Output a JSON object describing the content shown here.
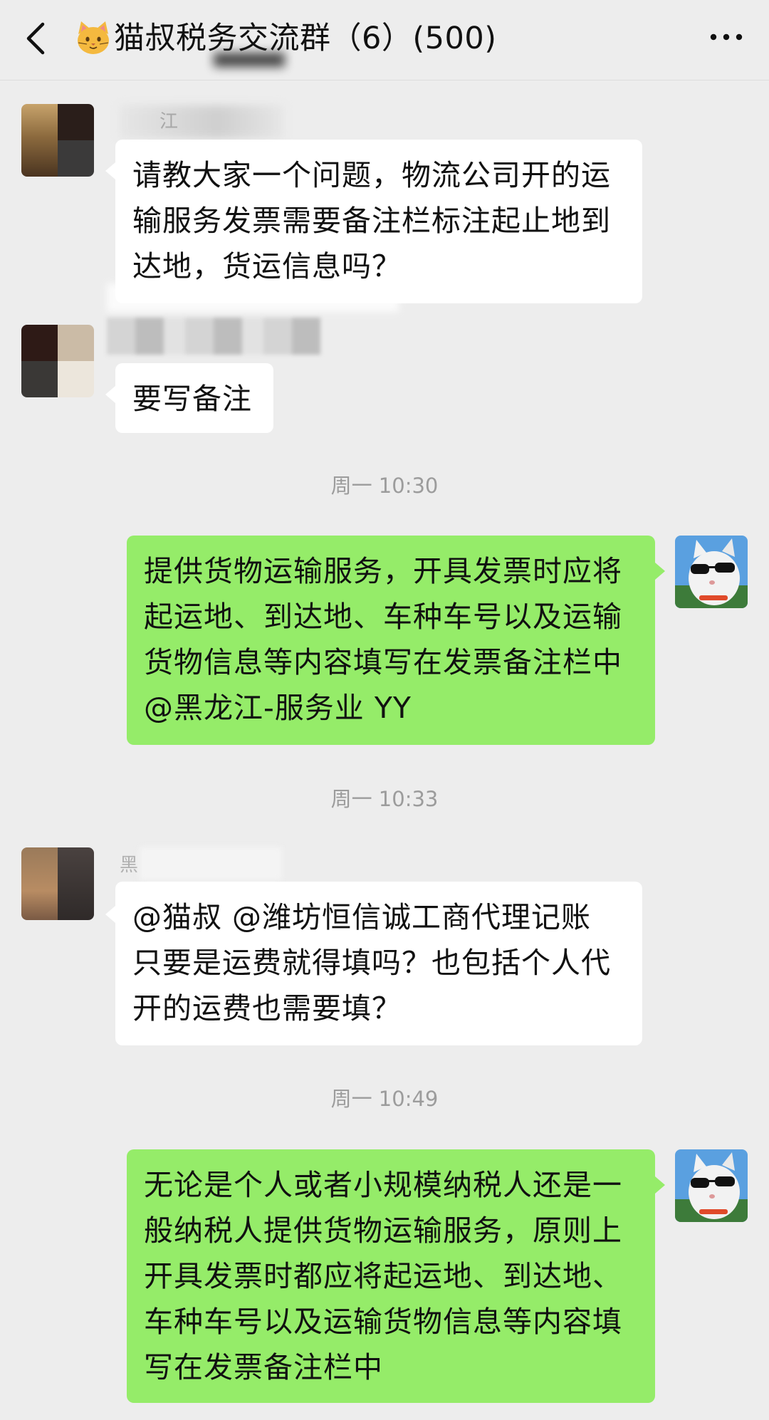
{
  "header": {
    "title": "猫叔税务交流群（6）(500)",
    "back_icon": "chevron-left-icon",
    "more_icon": "more-dots-icon",
    "emoji_icon": "cat-face-emoji-icon"
  },
  "messages": [
    {
      "direction": "in",
      "sender": "江",
      "text": "请教大家一个问题，物流公司开的运输服务发票需要备注栏标注起止地到达地，货运信息吗？"
    },
    {
      "direction": "in",
      "sender": "",
      "text": "要写备注"
    },
    {
      "direction": "out",
      "timestamp": "周一 10:30",
      "text": "提供货物运输服务，开具发票时应将起运地、到达地、车种车号以及运输货物信息等内容填写在发票备注栏中@黑龙江-服务业 YY"
    },
    {
      "direction": "in",
      "timestamp": "周一 10:33",
      "sender": "黑",
      "text": "@猫叔 @潍坊恒信诚工商代理记账\n只要是运费就得填吗？也包括个人代开的运费也需要填？"
    },
    {
      "direction": "out",
      "timestamp": "周一 10:49",
      "text": "无论是个人或者小规模纳税人还是一般纳税人提供货物运输服务，原则上开具发票时都应将起运地、到达地、车种车号以及运输货物信息等内容填写在发票备注栏中"
    }
  ],
  "colors": {
    "background": "#ededed",
    "outgoing_bubble": "#95ec69",
    "incoming_bubble": "#ffffff",
    "timestamp_text": "#9c9c9c"
  }
}
